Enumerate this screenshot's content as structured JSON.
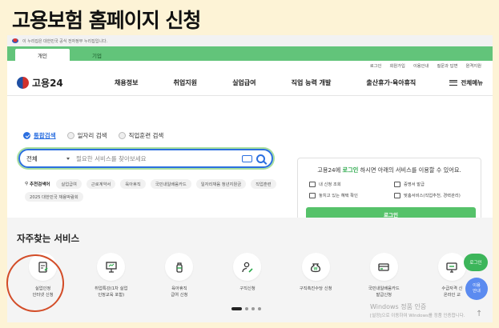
{
  "headline": "고용보험 홈페이지 신청",
  "gov_notice": "이 누리집은 대한민국 공식 전자정부 누리집입니다.",
  "tabs": [
    "개인",
    "기업"
  ],
  "util_links": [
    "로그인",
    "회원가입",
    "이용안내",
    "질문과 답변",
    "원격지원"
  ],
  "logo_text": "고용24",
  "menu": [
    "채용정보",
    "취업지원",
    "실업급여",
    "직업 능력 개발",
    "출산휴가·육아휴직"
  ],
  "all_menu": "전체메뉴",
  "search": {
    "options": [
      "통합검색",
      "일자리 검색",
      "직업훈련 검색"
    ],
    "scope": "전체",
    "placeholder": "필요한 서비스를 찾아보세요"
  },
  "recommended": {
    "title": "추천검색어",
    "chips": [
      "실업급여",
      "근로계약서",
      "육아휴직",
      "국민내일배움카드",
      "일자리채움 청년지원금",
      "직업훈련",
      "2025 대한민국 채용박람회"
    ]
  },
  "login_card": {
    "msg_prefix": "고용24에 ",
    "msg_link": "로그인",
    "msg_suffix": " 하시면 아래의 서비스를 이용할 수 있어요.",
    "items": [
      "내 신청 조회",
      "증명서 발급",
      "놓치고 있는 혜택 확인",
      "맞춤서비스(직업추천, 경력관리)"
    ],
    "button": "로그인"
  },
  "services": {
    "title": "자주찾는 서비스",
    "items": [
      {
        "label": "실업인정\n인터넷 신청",
        "icon": "doc-pen-icon"
      },
      {
        "label": "취업특강(1차 실업\n인정교육 포함)",
        "icon": "presentation-icon"
      },
      {
        "label": "육아휴직\n급여 신청",
        "icon": "baby-bottle-icon"
      },
      {
        "label": "구직신청",
        "icon": "person-edit-icon"
      },
      {
        "label": "구직촉진수당 신청",
        "icon": "money-bag-icon"
      },
      {
        "label": "국민내일배움카드\n발급신청",
        "icon": "card-icon"
      },
      {
        "label": "수급자격 신\n온라인 교",
        "icon": "monitor-icon"
      }
    ]
  },
  "float_login": "로그인",
  "float_guide": "이용\n안내",
  "watermark": {
    "line1": "Windows 정품 인증",
    "line2": "[설정]으로 이동하여 Windows를 정품 인증합니다."
  },
  "colors": {
    "accent_green": "#62c47a",
    "accent_blue": "#2b6fe0",
    "annotation": "#d34d28"
  }
}
